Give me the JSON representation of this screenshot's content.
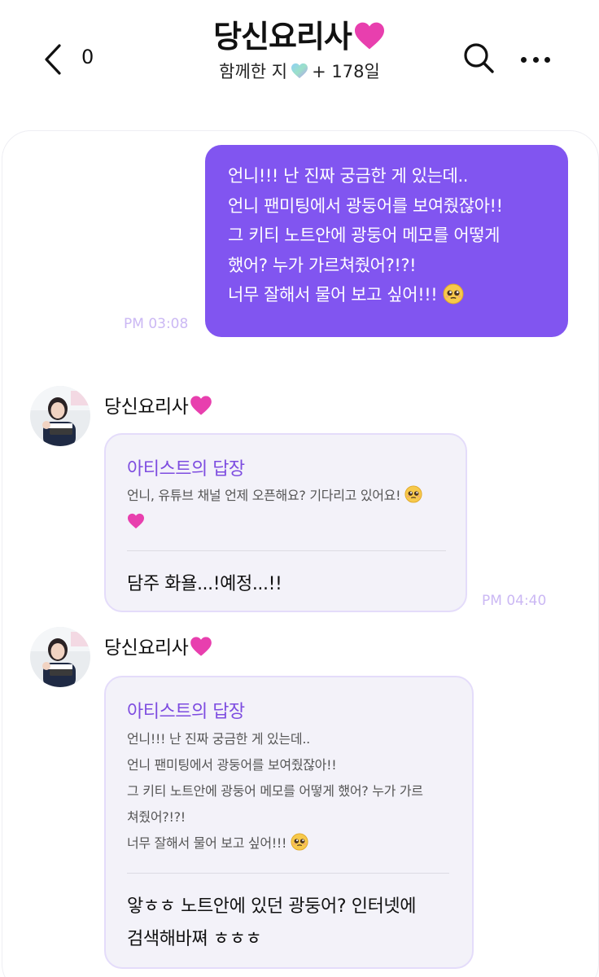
{
  "header": {
    "back_count": "0",
    "title": "당신요리사",
    "subtitle_prefix": "함께한 지",
    "subtitle_suffix": "+ 178일"
  },
  "colors": {
    "accent": "#8155f0",
    "reply_label": "#7d4ce0",
    "time": "#cbb8f4",
    "card_bg": "#f3f2f9",
    "heart": "#e83fae"
  },
  "my_message": {
    "lines": [
      "언니!!! 난 진짜 궁금한 게 있는데..",
      "언니 팬미팅에서 광둥어를 보여줬잖아!!",
      "그 키티 노트안에 광둥어 메모를 어떻게",
      "했어? 누가 가르쳐줬어?!?!",
      "너무 잘해서 물어 보고 싶어!!!"
    ],
    "time": "PM 03:08"
  },
  "replies": [
    {
      "sender": "당신요리사",
      "label": "아티스트의 답장",
      "quoted_lines": [
        "언니, 유튜브 채널 언제 오픈해요? 기다리고 있어요!"
      ],
      "answer_lines": [
        "담주 화욜...!예정...!!"
      ],
      "time": "PM 04:40"
    },
    {
      "sender": "당신요리사",
      "label": "아티스트의 답장",
      "quoted_lines": [
        "언니!!! 난 진짜 궁금한 게 있는데..",
        "언니 팬미팅에서 광둥어를 보여줬잖아!!",
        "그 키티 노트안에 광둥어 메모를 어떻게 했어? 누가 가르",
        "쳐줬어?!?!",
        "너무 잘해서 물어 보고 싶어!!!"
      ],
      "answer_lines": [
        "앟ㅎㅎ 노트안에 있던 광둥어? 인터넷에",
        "검색해바쪄 ㅎㅎㅎ"
      ]
    }
  ]
}
